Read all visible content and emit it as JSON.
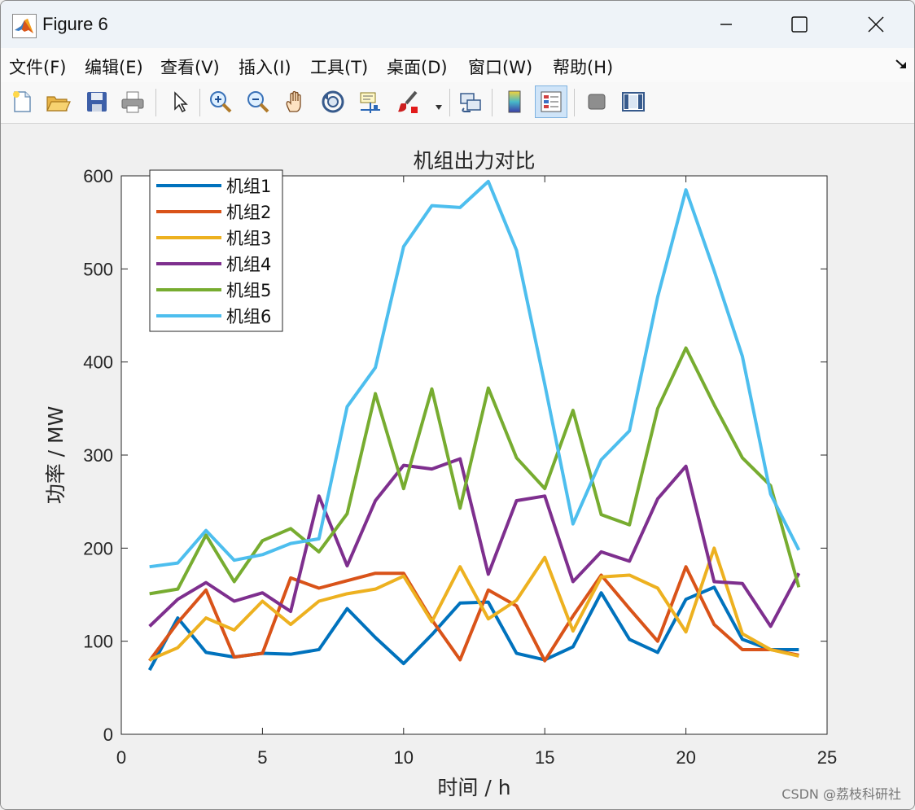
{
  "window": {
    "title": "Figure 6",
    "controls": [
      "minimize-icon",
      "maximize-icon",
      "close-icon"
    ]
  },
  "menubar": {
    "items": [
      "文件(F)",
      "编辑(E)",
      "查看(V)",
      "插入(I)",
      "工具(T)",
      "桌面(D)",
      "窗口(W)",
      "帮助(H)"
    ]
  },
  "toolbar": {
    "icons": [
      "new-figure-icon",
      "open-icon",
      "save-icon",
      "print-icon",
      "pointer-icon",
      "zoom-in-icon",
      "zoom-out-icon",
      "pan-icon",
      "rotate-3d-icon",
      "data-cursor-icon",
      "brush-icon",
      "link-plot-icon",
      "colorbar-icon",
      "legend-icon",
      "hide-plot-tools-icon",
      "show-plot-tools-icon"
    ],
    "active": "legend-icon"
  },
  "chart_data": {
    "type": "line",
    "title": "机组出力对比",
    "xlabel": "时间 / h",
    "ylabel": "功率 / MW",
    "xlim": [
      0,
      25
    ],
    "ylim": [
      0,
      600
    ],
    "xticks": [
      0,
      5,
      10,
      15,
      20,
      25
    ],
    "yticks": [
      0,
      100,
      200,
      300,
      400,
      500,
      600
    ],
    "grid": false,
    "legend_position": "top-left",
    "x": [
      1,
      2,
      3,
      4,
      5,
      6,
      7,
      8,
      9,
      10,
      11,
      12,
      13,
      14,
      15,
      16,
      17,
      18,
      19,
      20,
      21,
      22,
      23,
      24
    ],
    "series": [
      {
        "name": "机组1",
        "color": "#0072BD",
        "values": [
          69,
          125,
          88,
          83,
          87,
          86,
          91,
          135,
          104,
          76,
          107,
          141,
          142,
          87,
          80,
          94,
          152,
          102,
          88,
          145,
          158,
          102,
          91,
          91
        ]
      },
      {
        "name": "机组2",
        "color": "#D95319",
        "values": [
          79,
          120,
          155,
          83,
          87,
          168,
          157,
          165,
          173,
          173,
          123,
          80,
          155,
          138,
          79,
          127,
          171,
          135,
          100,
          180,
          118,
          91,
          91,
          85
        ]
      },
      {
        "name": "机组3",
        "color": "#EDB120",
        "values": [
          80,
          93,
          125,
          112,
          143,
          118,
          143,
          151,
          156,
          170,
          121,
          180,
          124,
          144,
          190,
          111,
          169,
          171,
          157,
          110,
          200,
          108,
          91,
          84
        ]
      },
      {
        "name": "机组4",
        "color": "#7E2F8E",
        "values": [
          116,
          145,
          163,
          143,
          152,
          132,
          256,
          181,
          251,
          289,
          285,
          296,
          172,
          251,
          256,
          164,
          196,
          186,
          253,
          288,
          164,
          162,
          116,
          173
        ]
      },
      {
        "name": "机组5",
        "color": "#77AC30",
        "values": [
          151,
          156,
          214,
          164,
          208,
          221,
          196,
          237,
          366,
          264,
          371,
          243,
          372,
          297,
          264,
          348,
          236,
          225,
          350,
          415,
          354,
          297,
          267,
          158
        ]
      },
      {
        "name": "机组6",
        "color": "#4DBEEE",
        "values": [
          180,
          184,
          219,
          187,
          193,
          205,
          210,
          352,
          394,
          524,
          568,
          566,
          594,
          520,
          376,
          226,
          295,
          326,
          470,
          585,
          498,
          406,
          258,
          198
        ]
      }
    ]
  },
  "watermark": "CSDN @荔枝科研社"
}
